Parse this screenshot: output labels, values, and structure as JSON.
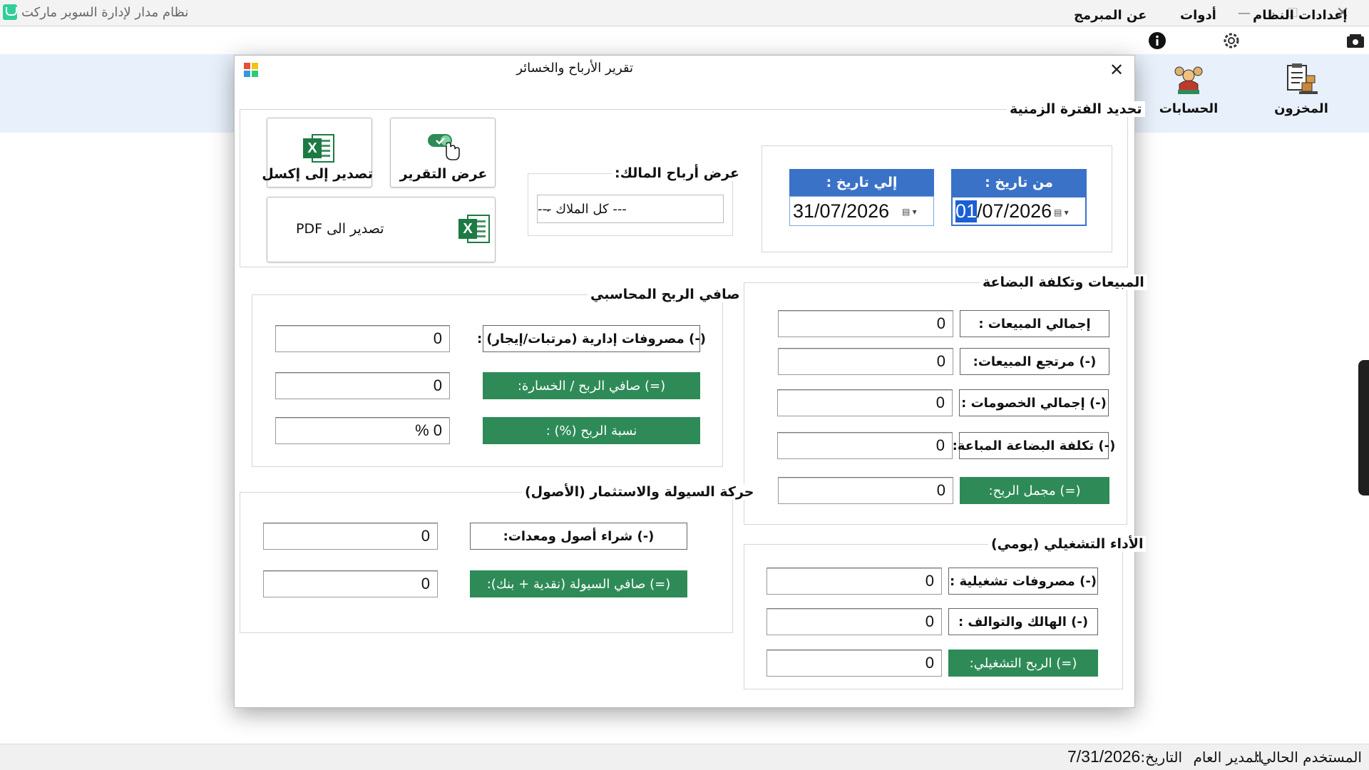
{
  "app": {
    "title": "نظام مدار لإدارة السوبر ماركت"
  },
  "window_controls": {
    "minimize": "—",
    "maximize": "☐",
    "close": "✕"
  },
  "menu": {
    "items": [
      {
        "label": "إعدادات النظام",
        "icon": "system-settings-icon"
      },
      {
        "label": "أدوات",
        "icon": "gear-icon"
      },
      {
        "label": "عن المبرمج",
        "icon": "info-icon"
      }
    ]
  },
  "toolbar": {
    "items": [
      {
        "label": "المخزون",
        "icon": "inventory-icon"
      },
      {
        "label": "الحسابات",
        "icon": "accounts-icon"
      }
    ]
  },
  "dialog": {
    "title": "تقرير الأرباح والخسائر",
    "close": "✕",
    "period": {
      "title": "تحديد الفترة الزمنية",
      "from_label": "من تاريخ :",
      "from_selected": "01",
      "from_rest": "/07/2026",
      "to_label": "إلي تاريخ :",
      "to_value": "31/07/2026"
    },
    "owner": {
      "title": "عرض أرباح المالك:",
      "selected": "--- كل الملاك ---"
    },
    "buttons": {
      "show_report": "عرض التقرير",
      "export_excel": "تصدير إلى إكسل",
      "export_pdf": "تصدير الى PDF"
    },
    "sales": {
      "title": "المبيعات وتكلفة البضاعة",
      "rows": [
        {
          "label": "إجمالي المبيعات :",
          "value": "0"
        },
        {
          "label": "(-) مرتجع المبيعات:",
          "value": "0"
        },
        {
          "label": "(-) إجمالي الخصومات :",
          "value": "0"
        },
        {
          "label": "(-) تكلفة البضاعة المباعة:",
          "value": "0"
        },
        {
          "label": "(=) مجمل الربح:",
          "value": "0"
        }
      ]
    },
    "operating": {
      "title": "الأداء التشغيلي (يومي)",
      "rows": [
        {
          "label": "(-) مصروفات تشغيلية :",
          "value": "0"
        },
        {
          "label": "(-) الهالك والتوالف :",
          "value": "0"
        },
        {
          "label": "(=) الربح التشغيلي:",
          "value": "0"
        }
      ]
    },
    "net_profit": {
      "title": "صافي الربح المحاسبي",
      "rows": [
        {
          "label": "(-) مصروفات إدارية (مرتبات/إيجار) :",
          "value": "0"
        },
        {
          "label": "(=) صافي الربح / الخسارة:",
          "value": "0"
        },
        {
          "label": "نسبة الربح (%) :",
          "value": "% 0"
        }
      ]
    },
    "cashflow": {
      "title": "حركة السيولة والاستثمار (الأصول)",
      "rows": [
        {
          "label": "(-) شراء أصول ومعدات:",
          "value": "0"
        },
        {
          "label": "(=)  صافي السيولة (نقدية + بنك):",
          "value": "0"
        }
      ]
    }
  },
  "status": {
    "user_label": "المستخدم الحالي:",
    "user_value": "المدير العام",
    "date_label": "التاريخ:",
    "date_value": "7/31/2026"
  },
  "colors": {
    "accent_blue": "#3a72c8",
    "green": "#2e8b57",
    "toolbar_bg": "#e8f0fb"
  }
}
